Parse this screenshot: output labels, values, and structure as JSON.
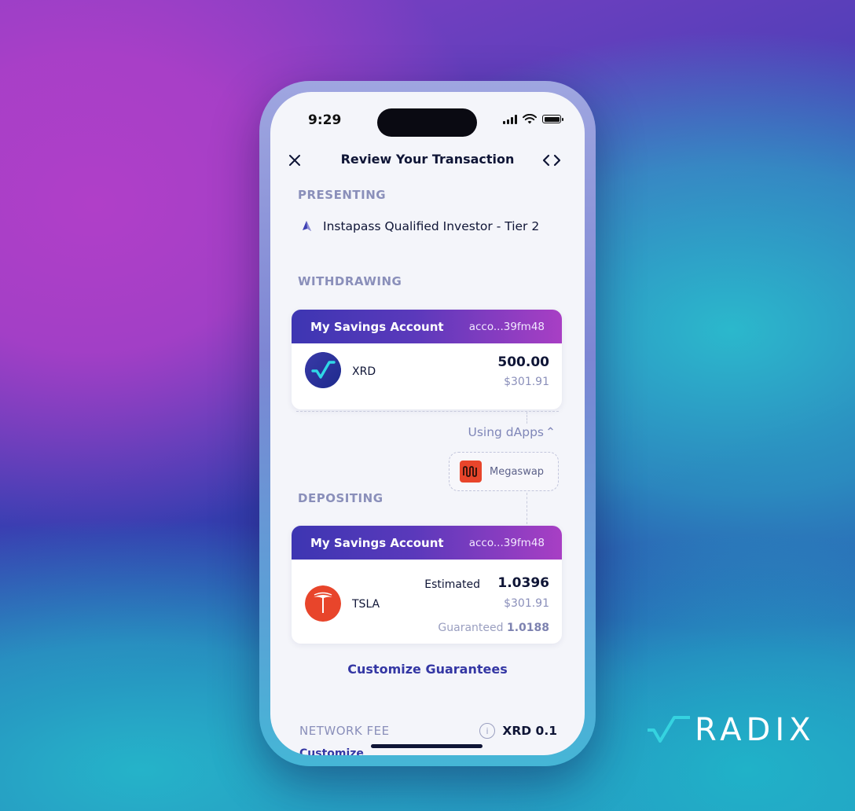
{
  "background": {
    "brand_wordmark": "RADIX",
    "colors": {
      "purple": "#b03fc8",
      "blue": "#2b3aa8",
      "teal": "#2bb8cc"
    }
  },
  "status_bar": {
    "time": "9:29"
  },
  "nav": {
    "title": "Review Your Transaction",
    "close_icon": "close-icon",
    "code_icon": "code-brackets-icon"
  },
  "presenting": {
    "label": "PRESENTING",
    "badge_name": "Instapass Qualified Investor - Tier 2"
  },
  "withdrawing": {
    "label": "WITHDRAWING",
    "account": {
      "name": "My Savings Account",
      "address": "acco...39fm48"
    },
    "asset": {
      "symbol": "XRD",
      "amount": "500.00",
      "fiat": "$301.91"
    }
  },
  "dapps": {
    "toggle_label": "Using dApps",
    "items": [
      {
        "name": "Megaswap",
        "color": "#e8452b"
      }
    ]
  },
  "depositing": {
    "label": "DEPOSITING",
    "account": {
      "name": "My Savings Account",
      "address": "acco...39fm48"
    },
    "asset": {
      "symbol": "TSLA",
      "estimated_label": "Estimated",
      "amount": "1.0396",
      "fiat": "$301.91",
      "guaranteed_label": "Guaranteed",
      "guaranteed_value": "1.0188",
      "color": "#e8452b"
    }
  },
  "customize_guarantees_label": "Customize Guarantees",
  "network_fee": {
    "label": "NETWORK FEE",
    "info_icon": "info-icon",
    "value": "XRD 0.1",
    "customize_label": "Customize"
  }
}
